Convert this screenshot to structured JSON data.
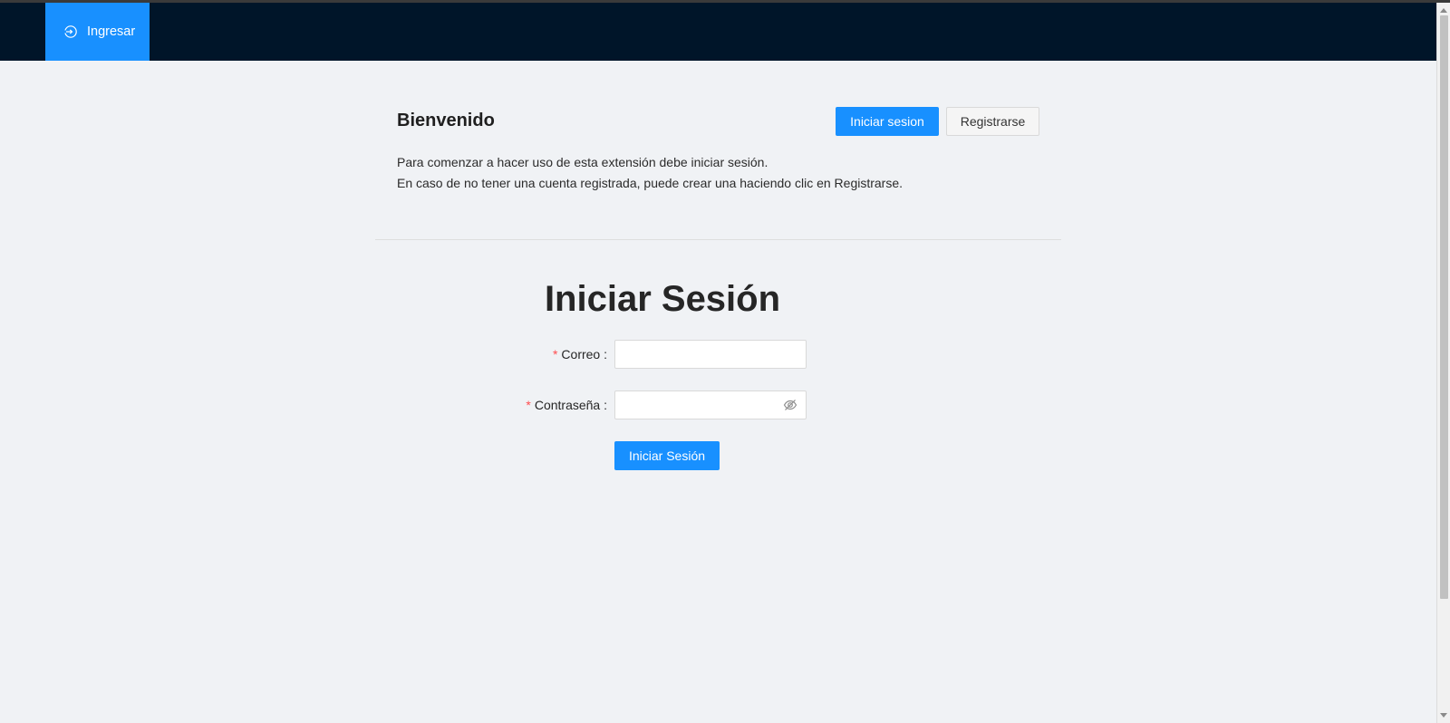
{
  "nav": {
    "items": [
      {
        "label": "Ingresar",
        "icon": "login-icon",
        "active": true
      }
    ]
  },
  "welcome": {
    "title": "Bienvenido",
    "login_button": "Iniciar sesion",
    "register_button": "Registrarse",
    "line1": "Para comenzar a hacer uso de esta extensión debe iniciar sesión.",
    "line2": "En caso de no tener una cuenta registrada, puede crear una haciendo clic en Registrarse."
  },
  "form": {
    "title": "Iniciar Sesión",
    "required_mark": "*",
    "email_label": "Correo",
    "email_value": "",
    "password_label": "Contraseña",
    "password_value": "",
    "password_toggle_icon": "eye-invisible-icon",
    "submit_label": "Iniciar Sesión"
  },
  "colors": {
    "header_bg": "#001529",
    "primary": "#1890ff",
    "page_bg": "#f0f2f5",
    "required": "#ff4d4f"
  }
}
